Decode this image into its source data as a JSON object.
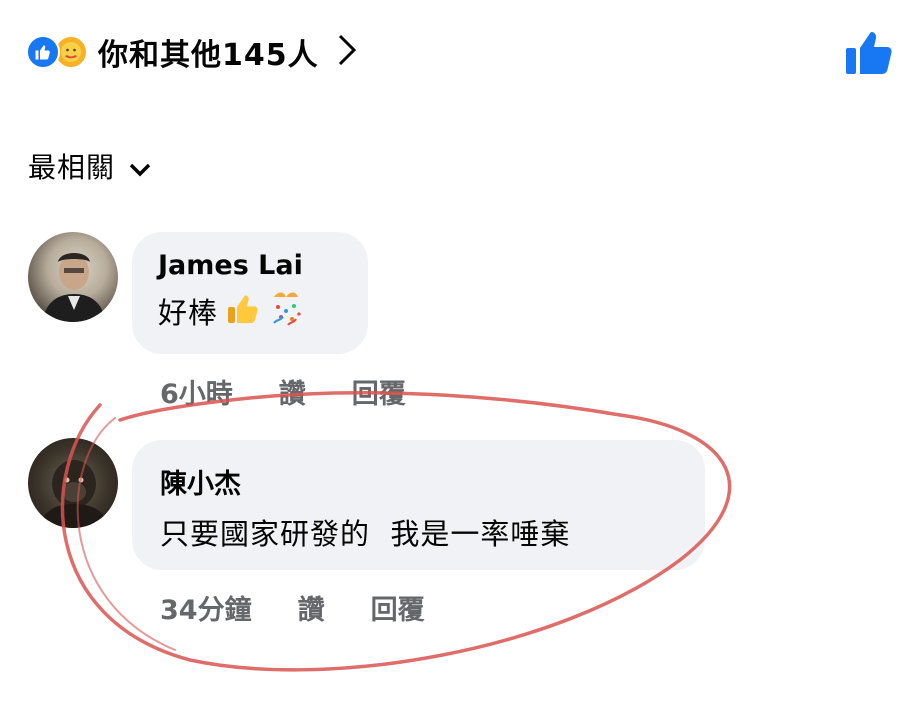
{
  "header": {
    "summary": "你和其他145人",
    "reaction_icons": [
      "like-icon",
      "care-icon"
    ],
    "colors": {
      "like_blue": "#1877f2",
      "care_yellow": "#f7b125"
    }
  },
  "sort": {
    "label": "最相關"
  },
  "comments": [
    {
      "author": "James Lai",
      "text": "好棒",
      "emojis": [
        "thumbs-up-icon",
        "party-popper-icon"
      ],
      "time": "6小時",
      "like_label": "讚",
      "reply_label": "回覆"
    },
    {
      "author": "陳小杰",
      "text": "只要國家研發的  我是一率唾棄",
      "time": "34分鐘",
      "like_label": "讚",
      "reply_label": "回覆"
    }
  ],
  "annotation": {
    "color": "#d9534f"
  },
  "colors": {
    "bubble": "#f0f2f5",
    "meta_text": "#65676b"
  }
}
